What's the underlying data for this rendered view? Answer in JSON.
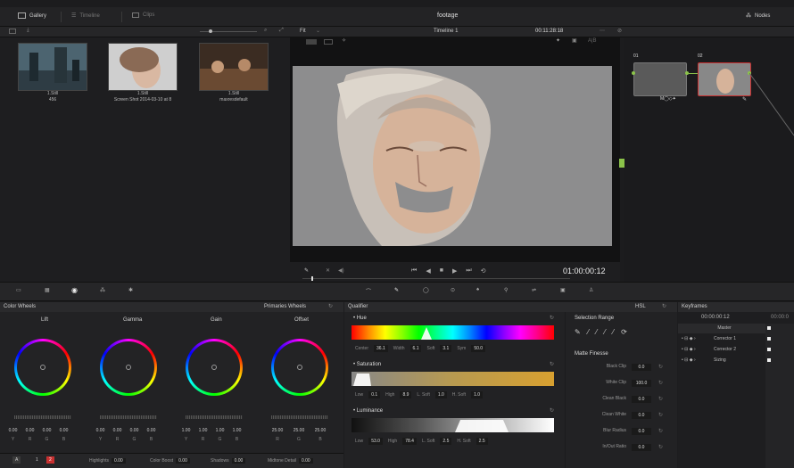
{
  "topbar": {
    "gallery": "Gallery",
    "timeline": "Timeline",
    "clips": "Clips",
    "title": "footage",
    "nodes": "Nodes"
  },
  "viewer_bar": {
    "fit": "Fit",
    "timeline_name": "Timeline 1",
    "timecode": "00:11:28:18"
  },
  "gallery": {
    "stills": [
      {
        "line1": "1.Still",
        "line2": "456"
      },
      {
        "line1": "1.Still",
        "line2": "Screen Shot 2014-03-10 at 8"
      },
      {
        "line1": "1.Still",
        "line2": "maxresdefault"
      }
    ]
  },
  "nodes": {
    "node1": "01",
    "node2": "02"
  },
  "transport": {
    "timecode": "01:00:00:12"
  },
  "color_wheels": {
    "header": "Color Wheels",
    "mode": "Primaries Wheels",
    "wheels": [
      {
        "label": "Lift",
        "values": [
          "0.00",
          "0.00",
          "0.00",
          "0.00"
        ],
        "channels": [
          "Y",
          "R",
          "G",
          "B"
        ]
      },
      {
        "label": "Gamma",
        "values": [
          "0.00",
          "0.00",
          "0.00",
          "0.00"
        ],
        "channels": [
          "Y",
          "R",
          "G",
          "B"
        ]
      },
      {
        "label": "Gain",
        "values": [
          "1.00",
          "1.00",
          "1.00",
          "1.00"
        ],
        "channels": [
          "Y",
          "R",
          "G",
          "B"
        ]
      },
      {
        "label": "Offset",
        "values": [
          "25.00",
          "25.00",
          "25.00"
        ],
        "channels": [
          "R",
          "G",
          "B"
        ]
      }
    ],
    "bottom": {
      "a": "A",
      "p1": "1",
      "p2": "2",
      "highlights_label": "Highlights",
      "highlights": "0.00",
      "color_boost_label": "Color Boost",
      "color_boost": "0.00",
      "shadows_label": "Shadows",
      "shadows": "0.00",
      "midtone_label": "Midtone Detail",
      "midtone": "0.00"
    }
  },
  "qualifier": {
    "header": "Qualifier",
    "mode": "HSL",
    "hue": {
      "title": "Hue",
      "center_label": "Center",
      "center": "36.1",
      "width_label": "Width",
      "width": "6.1",
      "soft_label": "Soft",
      "soft": "3.1",
      "sym_label": "Sym",
      "sym": "50.0"
    },
    "saturation": {
      "title": "Saturation",
      "low_label": "Low",
      "low": "0.1",
      "high_label": "High",
      "high": "8.9",
      "lsoft_label": "L. Soft",
      "lsoft": "1.0",
      "hsoft_label": "H. Soft",
      "hsoft": "1.0"
    },
    "luminance": {
      "title": "Luminance",
      "low_label": "Low",
      "low": "53.0",
      "high_label": "High",
      "high": "78.4",
      "lsoft_label": "L. Soft",
      "lsoft": "2.5",
      "hsoft_label": "H. Soft",
      "hsoft": "2.5"
    }
  },
  "selection": {
    "header": "Selection Range",
    "matte_finesse": "Matte Finesse",
    "rows": [
      {
        "label": "Black Clip",
        "value": "0.0"
      },
      {
        "label": "White Clip",
        "value": "100.0"
      },
      {
        "label": "Clean Black",
        "value": "0.0"
      },
      {
        "label": "Clean White",
        "value": "0.0"
      },
      {
        "label": "Blur Radius",
        "value": "0.0"
      },
      {
        "label": "In/Out Ratio",
        "value": "0.0"
      }
    ]
  },
  "keyframes": {
    "header": "Keyframes",
    "timecode": "00:00:00:12",
    "timecode2": "00:00:0",
    "master": "Master",
    "rows": [
      "Corrector 1",
      "Corrector 2",
      "Sizing"
    ]
  },
  "colors": {
    "accent": "#c83030",
    "node_border_selected": "#c83030",
    "qualifier_highlight": "#ffffff"
  }
}
